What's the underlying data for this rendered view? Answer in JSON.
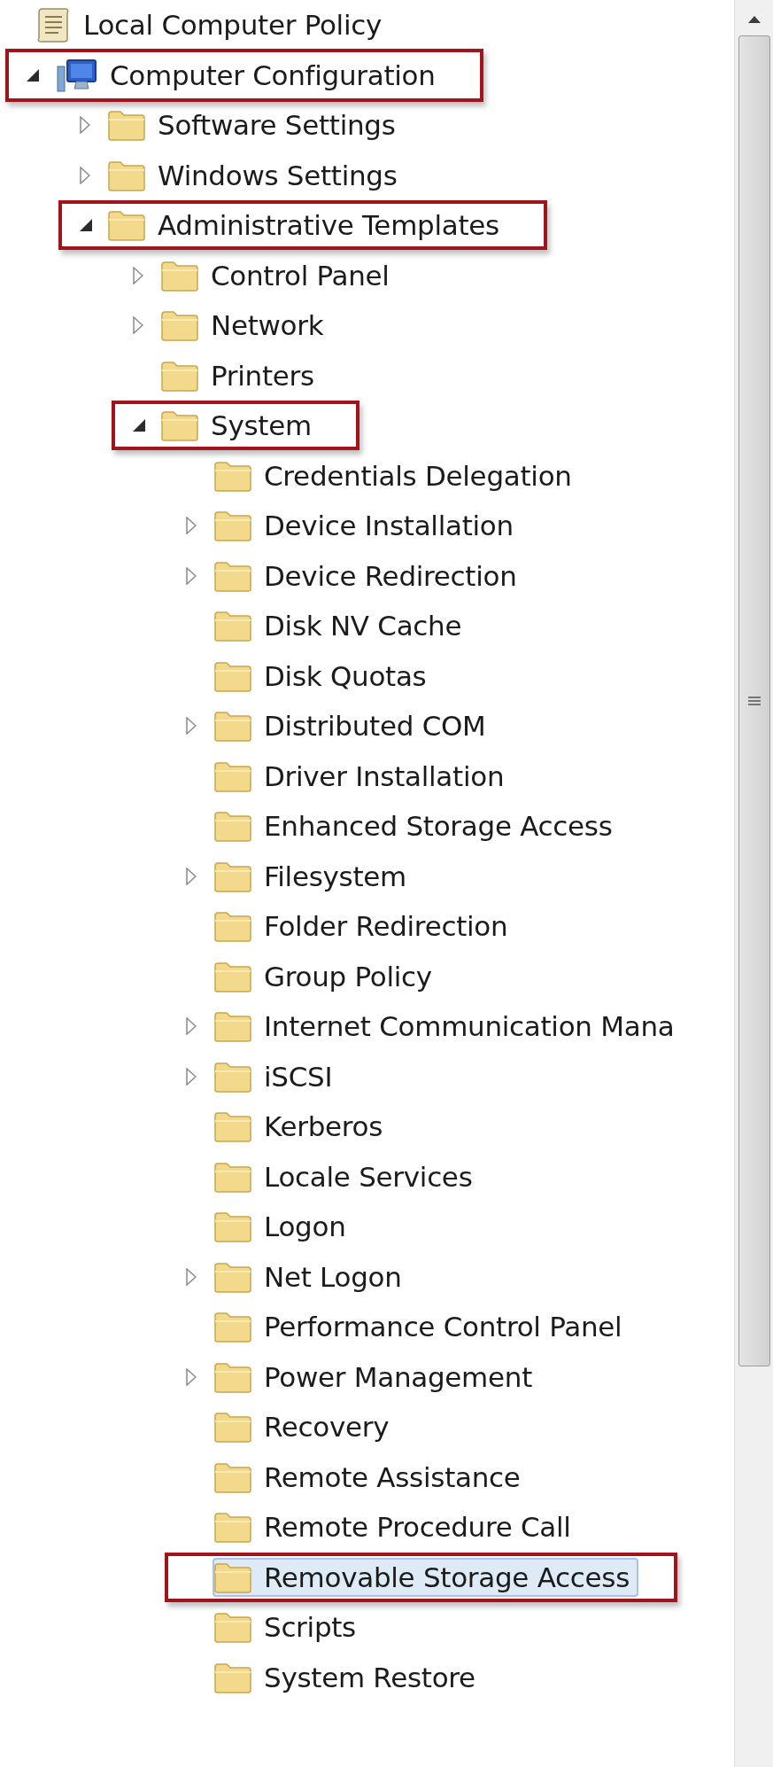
{
  "tree": [
    {
      "label": "Local Computer Policy",
      "kind": "policy",
      "expandable": false,
      "highlighted": false,
      "selected": false,
      "children": [
        {
          "label": "Computer Configuration",
          "kind": "computer",
          "expandable": true,
          "expanded": true,
          "highlighted": true,
          "selected": false,
          "children": [
            {
              "label": "Software Settings",
              "kind": "folder",
              "expandable": true,
              "expanded": false,
              "highlighted": false,
              "selected": false
            },
            {
              "label": "Windows Settings",
              "kind": "folder",
              "expandable": true,
              "expanded": false,
              "highlighted": false,
              "selected": false
            },
            {
              "label": "Administrative Templates",
              "kind": "folder",
              "expandable": true,
              "expanded": true,
              "highlighted": true,
              "selected": false,
              "children": [
                {
                  "label": "Control Panel",
                  "kind": "folder",
                  "expandable": true,
                  "expanded": false,
                  "highlighted": false,
                  "selected": false
                },
                {
                  "label": "Network",
                  "kind": "folder",
                  "expandable": true,
                  "expanded": false,
                  "highlighted": false,
                  "selected": false
                },
                {
                  "label": "Printers",
                  "kind": "folder",
                  "expandable": false,
                  "highlighted": false,
                  "selected": false
                },
                {
                  "label": "System",
                  "kind": "folder",
                  "expandable": true,
                  "expanded": true,
                  "highlighted": true,
                  "selected": false,
                  "children": [
                    {
                      "label": "Credentials Delegation",
                      "kind": "folder",
                      "expandable": false,
                      "highlighted": false,
                      "selected": false
                    },
                    {
                      "label": "Device Installation",
                      "kind": "folder",
                      "expandable": true,
                      "expanded": false,
                      "highlighted": false,
                      "selected": false
                    },
                    {
                      "label": "Device Redirection",
                      "kind": "folder",
                      "expandable": true,
                      "expanded": false,
                      "highlighted": false,
                      "selected": false
                    },
                    {
                      "label": "Disk NV Cache",
                      "kind": "folder",
                      "expandable": false,
                      "highlighted": false,
                      "selected": false
                    },
                    {
                      "label": "Disk Quotas",
                      "kind": "folder",
                      "expandable": false,
                      "highlighted": false,
                      "selected": false
                    },
                    {
                      "label": "Distributed COM",
                      "kind": "folder",
                      "expandable": true,
                      "expanded": false,
                      "highlighted": false,
                      "selected": false
                    },
                    {
                      "label": "Driver Installation",
                      "kind": "folder",
                      "expandable": false,
                      "highlighted": false,
                      "selected": false
                    },
                    {
                      "label": "Enhanced Storage Access",
                      "kind": "folder",
                      "expandable": false,
                      "highlighted": false,
                      "selected": false
                    },
                    {
                      "label": "Filesystem",
                      "kind": "folder",
                      "expandable": true,
                      "expanded": false,
                      "highlighted": false,
                      "selected": false
                    },
                    {
                      "label": "Folder Redirection",
                      "kind": "folder",
                      "expandable": false,
                      "highlighted": false,
                      "selected": false
                    },
                    {
                      "label": "Group Policy",
                      "kind": "folder",
                      "expandable": false,
                      "highlighted": false,
                      "selected": false
                    },
                    {
                      "label": "Internet Communication Mana",
                      "kind": "folder",
                      "expandable": true,
                      "expanded": false,
                      "highlighted": false,
                      "selected": false
                    },
                    {
                      "label": "iSCSI",
                      "kind": "folder",
                      "expandable": true,
                      "expanded": false,
                      "highlighted": false,
                      "selected": false
                    },
                    {
                      "label": "Kerberos",
                      "kind": "folder",
                      "expandable": false,
                      "highlighted": false,
                      "selected": false
                    },
                    {
                      "label": "Locale Services",
                      "kind": "folder",
                      "expandable": false,
                      "highlighted": false,
                      "selected": false
                    },
                    {
                      "label": "Logon",
                      "kind": "folder",
                      "expandable": false,
                      "highlighted": false,
                      "selected": false
                    },
                    {
                      "label": "Net Logon",
                      "kind": "folder",
                      "expandable": true,
                      "expanded": false,
                      "highlighted": false,
                      "selected": false
                    },
                    {
                      "label": "Performance Control Panel",
                      "kind": "folder",
                      "expandable": false,
                      "highlighted": false,
                      "selected": false
                    },
                    {
                      "label": "Power Management",
                      "kind": "folder",
                      "expandable": true,
                      "expanded": false,
                      "highlighted": false,
                      "selected": false
                    },
                    {
                      "label": "Recovery",
                      "kind": "folder",
                      "expandable": false,
                      "highlighted": false,
                      "selected": false
                    },
                    {
                      "label": "Remote Assistance",
                      "kind": "folder",
                      "expandable": false,
                      "highlighted": false,
                      "selected": false
                    },
                    {
                      "label": "Remote Procedure Call",
                      "kind": "folder",
                      "expandable": false,
                      "highlighted": false,
                      "selected": false
                    },
                    {
                      "label": "Removable Storage Access",
                      "kind": "folder",
                      "expandable": false,
                      "highlighted": true,
                      "selected": true
                    },
                    {
                      "label": "Scripts",
                      "kind": "folder",
                      "expandable": false,
                      "highlighted": false,
                      "selected": false
                    },
                    {
                      "label": "System Restore",
                      "kind": "folder",
                      "expandable": false,
                      "highlighted": false,
                      "selected": false
                    }
                  ]
                }
              ]
            }
          ]
        }
      ]
    }
  ]
}
